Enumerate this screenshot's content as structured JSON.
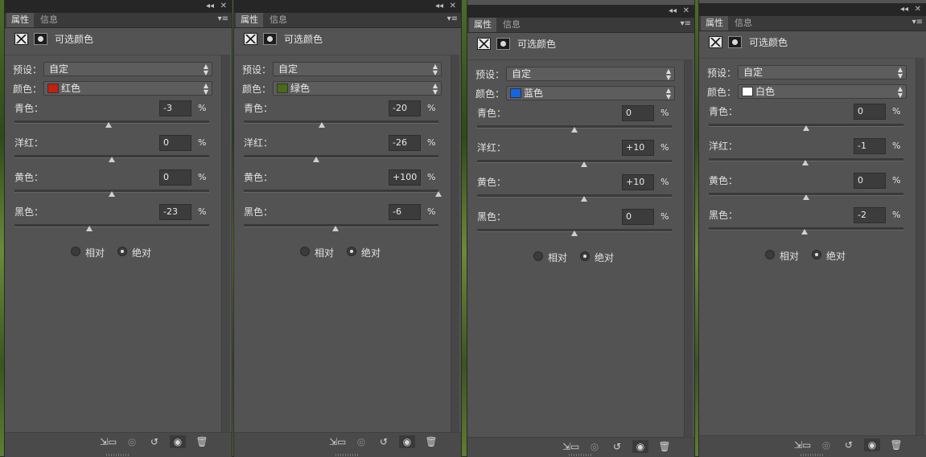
{
  "panels": [
    {
      "tabs": [
        "属性",
        "信息"
      ],
      "title": "可选颜色",
      "preset_label": "预设：",
      "preset_value": "自定",
      "color_label": "颜色：",
      "color_value": "红色",
      "swatch": "#c4200e",
      "sliders": [
        {
          "label": "青色：",
          "value": "-3",
          "level": -3
        },
        {
          "label": "洋红：",
          "value": "0",
          "level": 0
        },
        {
          "label": "黄色：",
          "value": "0",
          "level": 0
        },
        {
          "label": "黑色：",
          "value": "-23",
          "level": -23
        }
      ],
      "pct": "%",
      "mode_relative": "相对",
      "mode_absolute": "绝对",
      "mode_selected": "absolute"
    },
    {
      "tabs": [
        "属性",
        "信息"
      ],
      "title": "可选颜色",
      "preset_label": "预设：",
      "preset_value": "自定",
      "color_label": "颜色：",
      "color_value": "绿色",
      "swatch": "#4a6a14",
      "sliders": [
        {
          "label": "青色：",
          "value": "-20",
          "level": -20
        },
        {
          "label": "洋红：",
          "value": "-26",
          "level": -26
        },
        {
          "label": "黄色：",
          "value": "+100",
          "level": 100
        },
        {
          "label": "黑色：",
          "value": "-6",
          "level": -6
        }
      ],
      "pct": "%",
      "mode_relative": "相对",
      "mode_absolute": "绝对",
      "mode_selected": "absolute"
    },
    {
      "tabs": [
        "属性",
        "信息"
      ],
      "title": "可选颜色",
      "preset_label": "预设：",
      "preset_value": "自定",
      "color_label": "颜色：",
      "color_value": "蓝色",
      "swatch": "#1464e6",
      "sliders": [
        {
          "label": "青色：",
          "value": "0",
          "level": 0
        },
        {
          "label": "洋红：",
          "value": "+10",
          "level": 10
        },
        {
          "label": "黄色：",
          "value": "+10",
          "level": 10
        },
        {
          "label": "黑色：",
          "value": "0",
          "level": 0
        }
      ],
      "pct": "%",
      "mode_relative": "相对",
      "mode_absolute": "绝对",
      "mode_selected": "absolute"
    },
    {
      "tabs": [
        "属性",
        "信息"
      ],
      "title": "可选颜色",
      "preset_label": "预设：",
      "preset_value": "自定",
      "color_label": "颜色：",
      "color_value": "白色",
      "swatch": "#ffffff",
      "sliders": [
        {
          "label": "青色：",
          "value": "0",
          "level": 0
        },
        {
          "label": "洋红：",
          "value": "-1",
          "level": -1
        },
        {
          "label": "黄色：",
          "value": "0",
          "level": 0
        },
        {
          "label": "黑色：",
          "value": "-2",
          "level": -2
        }
      ],
      "pct": "%",
      "mode_relative": "相对",
      "mode_absolute": "绝对",
      "mode_selected": "absolute"
    }
  ],
  "bottom_icons": [
    "clip-to-layer-icon",
    "visibility-previous-icon",
    "reset-icon",
    "eye-icon",
    "trash-icon"
  ]
}
